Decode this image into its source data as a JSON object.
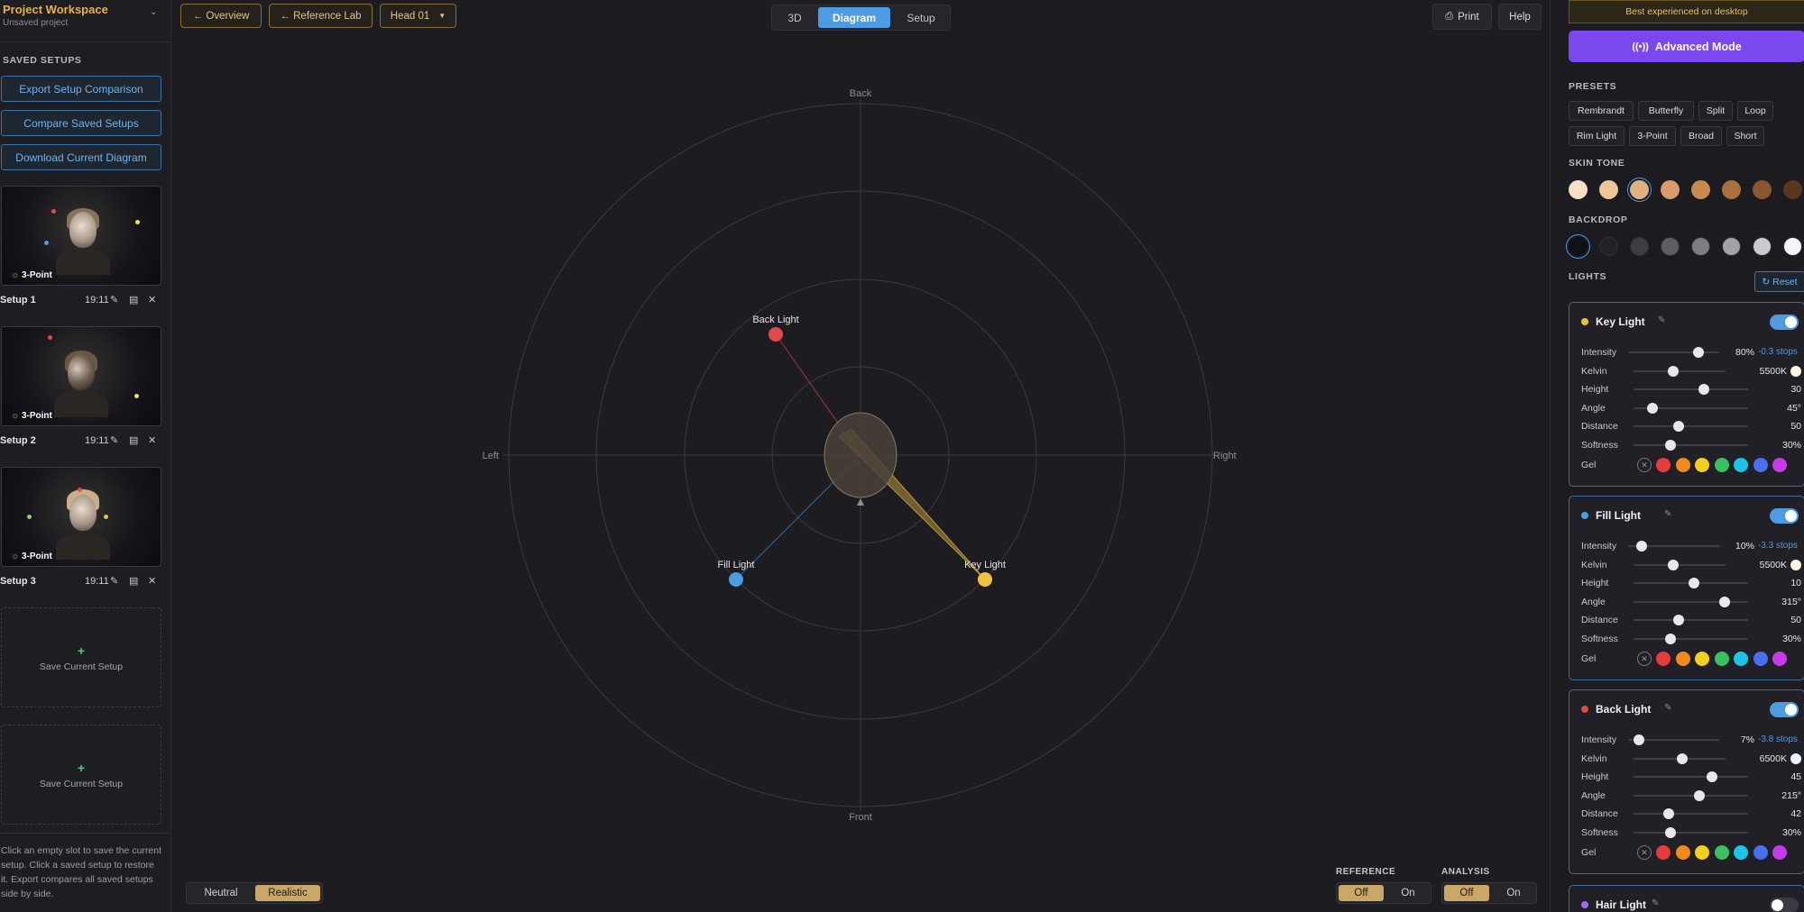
{
  "workspace": {
    "title": "Project Workspace",
    "subtitle": "Unsaved project"
  },
  "saved_setups": {
    "heading": "SAVED SETUPS",
    "actions": [
      "Export Setup Comparison",
      "Compare Saved Setups",
      "Download Current Diagram"
    ],
    "items": [
      {
        "name": "Setup 1",
        "time": "19:11",
        "badge": "3-Point"
      },
      {
        "name": "Setup 2",
        "time": "19:11",
        "badge": "3-Point"
      },
      {
        "name": "Setup 3",
        "time": "19:11",
        "badge": "3-Point"
      }
    ],
    "empty_label": "Save Current Setup",
    "hint": "Click an empty slot to save the current setup. Click a saved setup to restore it. Export compares all saved setups side by side."
  },
  "topbar": {
    "overview": "← Overview",
    "reference_lab": "← Reference Lab",
    "head": "Head 01",
    "views": [
      "3D",
      "Diagram",
      "Setup"
    ],
    "active_view": "Diagram",
    "print": "Print",
    "help": "Help"
  },
  "diagram": {
    "directions": {
      "back": "Back",
      "front": "Front",
      "left": "Left",
      "right": "Right"
    },
    "lights": [
      {
        "name": "Back Light",
        "color": "#e04a4a",
        "angle": 215
      },
      {
        "name": "Fill Light",
        "color": "#4d9be0",
        "angle": 315
      },
      {
        "name": "Key Light",
        "color": "#f0c040",
        "angle": 45
      }
    ]
  },
  "render_mode": {
    "options": [
      "Neutral",
      "Realistic"
    ],
    "selected": "Realistic"
  },
  "reference": {
    "label": "REFERENCE",
    "options": [
      "Off",
      "On"
    ],
    "selected": "Off"
  },
  "analysis": {
    "label": "ANALYSIS",
    "options": [
      "Off",
      "On"
    ],
    "selected": "Off"
  },
  "right": {
    "banner": "Best experienced on desktop",
    "advanced": "Advanced Mode",
    "presets_heading": "PRESETS",
    "presets": [
      "Rembrandt",
      "Butterfly",
      "Split",
      "Loop",
      "Rim Light",
      "3-Point",
      "Broad",
      "Short"
    ],
    "skin_heading": "SKIN TONE",
    "skin_tones": [
      "#f6dfc5",
      "#edc597",
      "#e0b282",
      "#d89a6e",
      "#c98a52",
      "#a8703f",
      "#8a5733",
      "#5c3720"
    ],
    "skin_selected": 2,
    "backdrop_heading": "BACKDROP",
    "backdrops": [
      "#0f1114",
      "#232326",
      "#3e3e42",
      "#5e5e62",
      "#7e7e82",
      "#a2a2a6",
      "#cacaca",
      "#f4f4f4"
    ],
    "backdrop_selected": 0,
    "lights_heading": "LIGHTS",
    "reset": "↻ Reset",
    "gel_label": "Gel",
    "gel_colors": [
      "#e63b3b",
      "#f08a1c",
      "#f2cf1d",
      "#39c060",
      "#1ac6e4",
      "#4a6ef0",
      "#c53bea"
    ],
    "light_cards": [
      {
        "name": "Key Light",
        "color": "#f0c040",
        "enabled": true,
        "intensity": "80%",
        "intensity_pct": 80,
        "stops": "-0.3 stops",
        "kelvin": "5500K",
        "kelvin_frac": 0.42,
        "kelvin_color": "#fff5e4",
        "height": "30",
        "height_pct": 63,
        "angle": "45°",
        "angle_pct": 13,
        "distance": "50",
        "distance_pct": 38,
        "softness": "30%",
        "softness_pct": 30
      },
      {
        "name": "Fill Light",
        "color": "#4d9be0",
        "enabled": true,
        "intensity": "10%",
        "intensity_pct": 10,
        "stops": "-3.3 stops",
        "kelvin": "5500K",
        "kelvin_frac": 0.42,
        "kelvin_color": "#fff5e4",
        "height": "10",
        "height_pct": 53,
        "angle": "315°",
        "angle_pct": 83,
        "distance": "50",
        "distance_pct": 38,
        "softness": "30%",
        "softness_pct": 30
      },
      {
        "name": "Back Light",
        "color": "#e04a4a",
        "enabled": true,
        "intensity": "7%",
        "intensity_pct": 7,
        "stops": "-3.8 stops",
        "kelvin": "6500K",
        "kelvin_frac": 0.53,
        "kelvin_color": "#eef3ff",
        "height": "45",
        "height_pct": 70,
        "angle": "215°",
        "angle_pct": 58,
        "distance": "42",
        "distance_pct": 29,
        "softness": "30%",
        "softness_pct": 30
      }
    ],
    "hair_light": {
      "name": "Hair Light",
      "color": "#9b6ef0",
      "enabled": false
    },
    "row_labels": [
      "Intensity",
      "Kelvin",
      "Height",
      "Angle",
      "Distance",
      "Softness"
    ]
  }
}
